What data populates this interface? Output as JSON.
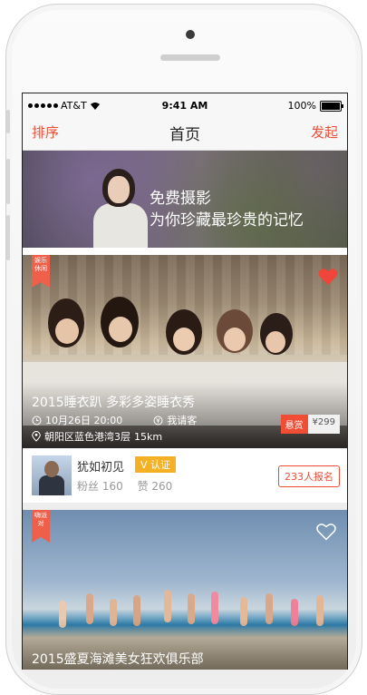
{
  "status_bar": {
    "carrier": "AT&T",
    "time": "9:41 AM",
    "battery": "100%"
  },
  "nav": {
    "left": "排序",
    "title": "首页",
    "right": "发起"
  },
  "banner": {
    "line1": "免费摄影",
    "line2": "为你珍藏最珍贵的记忆"
  },
  "card1": {
    "ribbon": "娱乐休闲",
    "title": "2015睡衣趴 多彩多姿睡衣秀",
    "date": "10月26日 20:00",
    "payer": "我请客",
    "location": "朝阳区蓝色港湾3层",
    "distance": "15km",
    "reward_label": "悬赏",
    "reward_value": "¥299",
    "favorited": true
  },
  "user": {
    "name": "犹如初见",
    "verified_label": "V 认证",
    "fans": "粉丝 160",
    "likes": "赞 260",
    "signup": "233人报名"
  },
  "card2": {
    "ribbon": "嗨派对",
    "title": "2015盛夏海滩美女狂欢俱乐部",
    "favorited": false
  },
  "colors": {
    "accent": "#ef4d36",
    "verified": "#f4b125"
  },
  "icons": [
    "wifi-icon",
    "battery-icon",
    "clock-icon",
    "yuan-icon",
    "location-icon",
    "heart-icon",
    "heart-outline-icon"
  ]
}
